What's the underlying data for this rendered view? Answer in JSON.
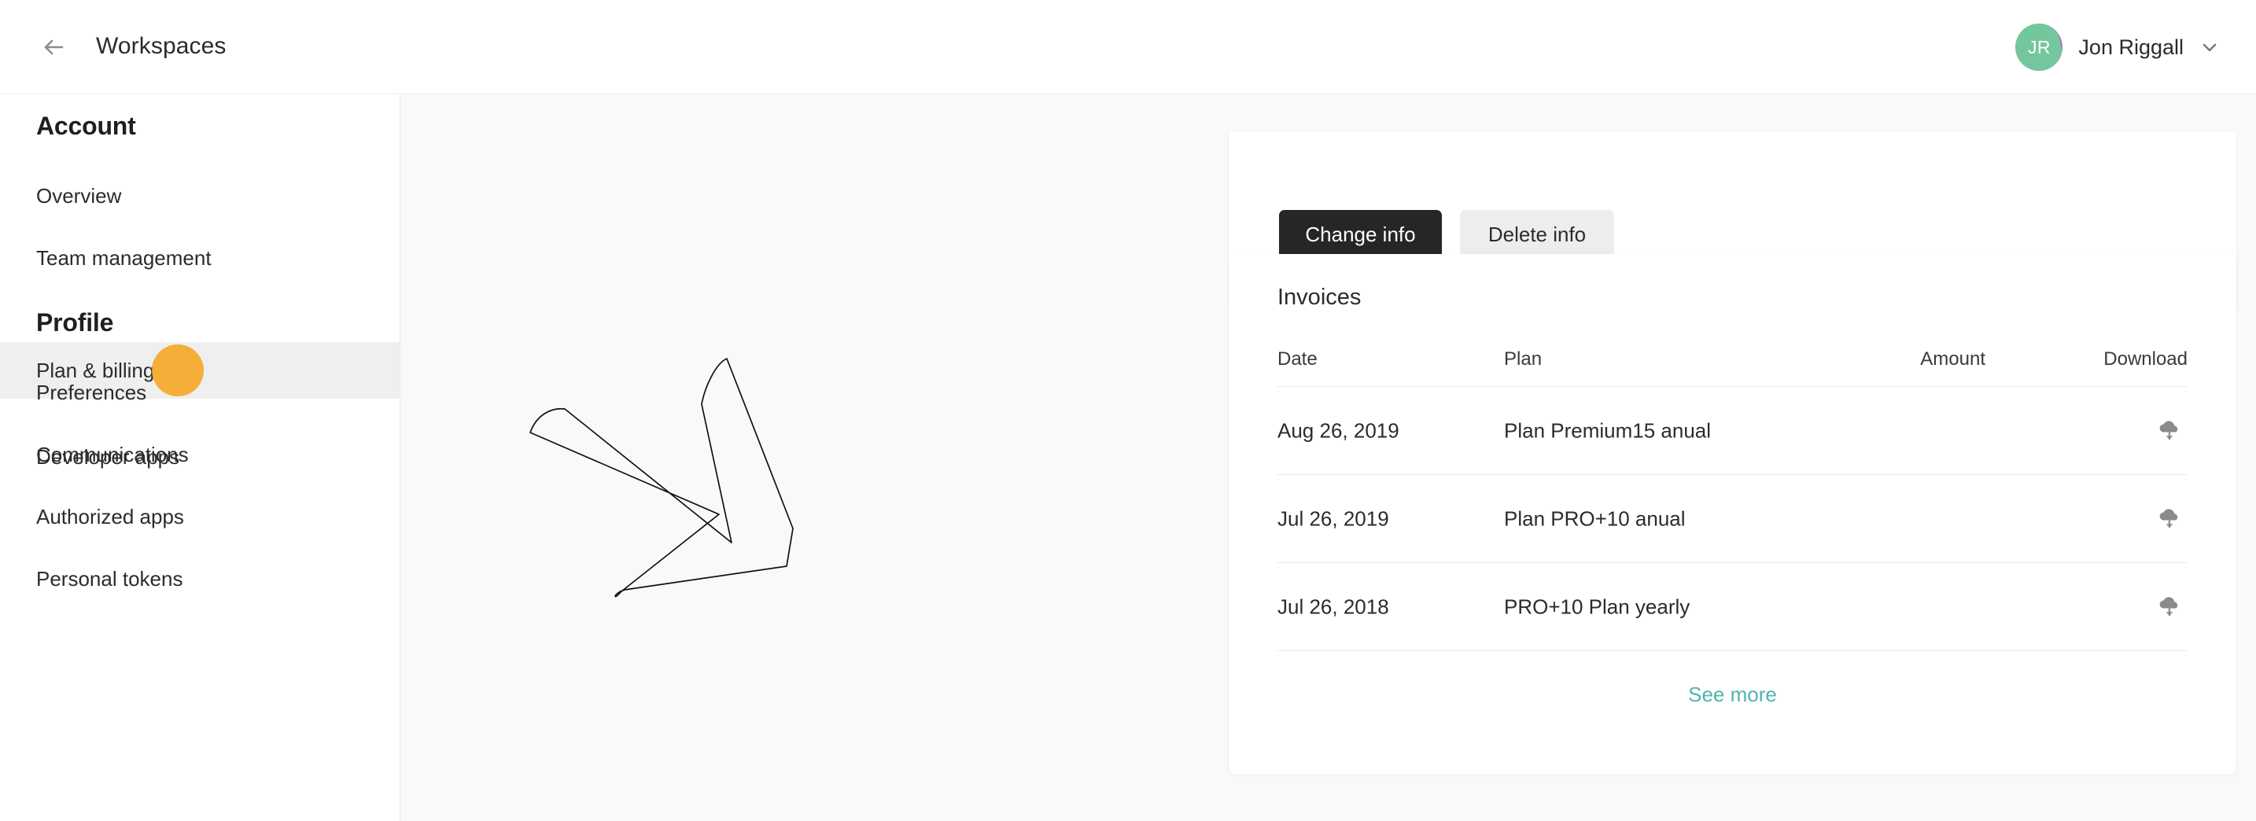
{
  "header": {
    "back_icon": "arrow-left-icon",
    "title": "Workspaces",
    "user": {
      "initials": "JR",
      "name": "Jon Riggall",
      "caret_icon": "chevron-down-icon",
      "avatar_colors": [
        "#74C69D",
        "#A481C4"
      ]
    }
  },
  "sidebar": {
    "sections": [
      {
        "heading": "Account",
        "items": [
          {
            "label": "Overview",
            "active": false
          },
          {
            "label": "Team management",
            "active": false
          },
          {
            "label": "Plan & billing",
            "active": true
          },
          {
            "label": "Developer apps",
            "active": false
          }
        ]
      },
      {
        "heading": "Profile",
        "items": [
          {
            "label": "Preferences",
            "active": false
          },
          {
            "label": "Communications",
            "active": false
          },
          {
            "label": "Authorized apps",
            "active": false
          },
          {
            "label": "Personal tokens",
            "active": false
          }
        ]
      }
    ],
    "active_row_bg": "#EFEFEF"
  },
  "click_indicator": {
    "color": "#F5A623",
    "target": "Plan & billing"
  },
  "info_card": {
    "change_label": "Change info",
    "delete_label": "Delete info",
    "change_bg": "#262626",
    "delete_bg": "#EDEDED"
  },
  "invoices": {
    "title": "Invoices",
    "columns": [
      "Date",
      "Plan",
      "Amount",
      "Download"
    ],
    "rows": [
      {
        "date": "Aug 26, 2019",
        "plan": "Plan Premium15 anual",
        "amount": "",
        "download_icon": "cloud-download-icon"
      },
      {
        "date": "Jul 26, 2019",
        "plan": "Plan PRO+10 anual",
        "amount": "",
        "download_icon": "cloud-download-icon"
      },
      {
        "date": "Jul 26, 2018",
        "plan": "PRO+10 Plan yearly",
        "amount": "",
        "download_icon": "cloud-download-icon"
      }
    ],
    "see_more_label": "See more",
    "see_more_color": "#4DB6AC"
  },
  "annotation": {
    "shape": "hand-drawn-arrow",
    "stroke": "#111111"
  }
}
